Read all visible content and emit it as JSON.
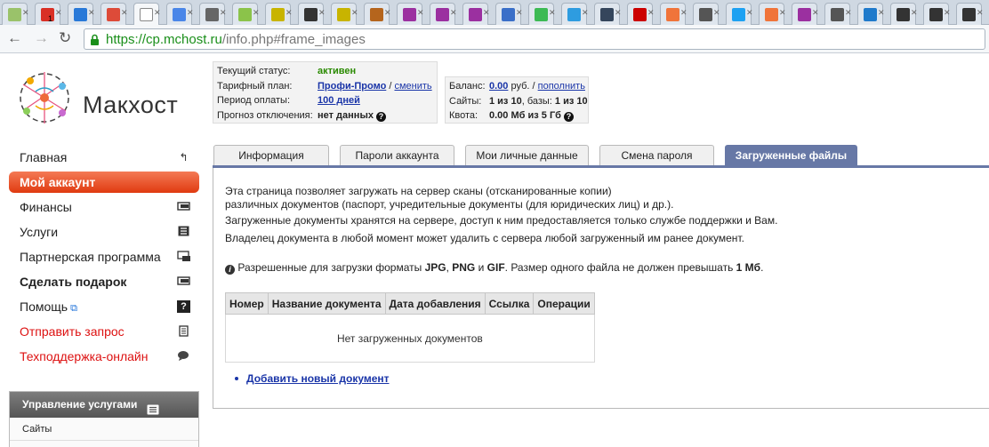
{
  "browser": {
    "tabs": [
      {
        "icon": "favicon-generic-icon",
        "color": "#9ac26a",
        "badge": ""
      },
      {
        "icon": "gmail-icon",
        "color": "#d93025",
        "badge": "1"
      },
      {
        "icon": "favicon-generic-icon",
        "color": "#2979d8",
        "badge": ""
      },
      {
        "icon": "google-plus-icon",
        "color": "#dd4b39",
        "badge": ""
      },
      {
        "icon": "makhost-icon",
        "color": "#ffffff",
        "badge": "",
        "active": true
      },
      {
        "icon": "google-icon",
        "color": "#4a86e8",
        "badge": ""
      },
      {
        "icon": "favicon-generic-icon",
        "color": "#666666",
        "badge": ""
      },
      {
        "icon": "favicon-generic-icon",
        "color": "#8bc34a",
        "badge": ""
      },
      {
        "icon": "favicon-generic-icon",
        "color": "#c8b400",
        "badge": ""
      },
      {
        "icon": "yandex-icon",
        "color": "#333333",
        "badge": ""
      },
      {
        "icon": "favicon-generic-icon",
        "color": "#c8b400",
        "badge": ""
      },
      {
        "icon": "favicon-generic-icon",
        "color": "#b5651d",
        "badge": ""
      },
      {
        "icon": "favicon-generic-icon",
        "color": "#9b30a0",
        "badge": ""
      },
      {
        "icon": "favicon-generic-icon",
        "color": "#9b30a0",
        "badge": ""
      },
      {
        "icon": "favicon-generic-icon",
        "color": "#9b30a0",
        "badge": ""
      },
      {
        "icon": "document-icon",
        "color": "#3a6fc8",
        "badge": ""
      },
      {
        "icon": "chrome-icon",
        "color": "#3cba54",
        "badge": ""
      },
      {
        "icon": "favicon-generic-icon",
        "color": "#2e9ce0",
        "badge": ""
      },
      {
        "icon": "tumblr-icon",
        "color": "#35465c",
        "badge": ""
      },
      {
        "icon": "russia-flag-icon",
        "color": "#cc0000",
        "badge": ""
      },
      {
        "icon": "favicon-generic-icon",
        "color": "#f0743a",
        "badge": ""
      },
      {
        "icon": "speaker-icon",
        "color": "#555555",
        "badge": ""
      },
      {
        "icon": "twitter-icon",
        "color": "#1da1f2",
        "badge": ""
      },
      {
        "icon": "favicon-generic-icon",
        "color": "#f0743a",
        "badge": ""
      },
      {
        "icon": "favicon-generic-icon",
        "color": "#9b30a0",
        "badge": ""
      },
      {
        "icon": "speaker-icon",
        "color": "#555555",
        "badge": ""
      },
      {
        "icon": "dropbox-icon",
        "color": "#1f7acb",
        "badge": ""
      },
      {
        "icon": "favicon-generic-icon",
        "color": "#333333",
        "badge": ""
      },
      {
        "icon": "favicon-generic-icon",
        "color": "#333333",
        "badge": ""
      },
      {
        "icon": "favicon-generic-icon",
        "color": "#333333",
        "badge": ""
      }
    ],
    "url": {
      "scheme": "https://",
      "host": "cp.mchost.ru",
      "path": "/info.php#frame_images"
    }
  },
  "header": {
    "logo_text": "Макхост",
    "status": [
      {
        "label": "Текущий статус:",
        "value": "активен"
      },
      {
        "label": "Тарифный план:",
        "value": "Профи-Промо",
        "sep": " / ",
        "action": "сменить"
      },
      {
        "label": "Период оплаты:",
        "value": "100 дней"
      },
      {
        "label": "Прогноз отключения:",
        "value": "нет данных"
      }
    ],
    "balance": {
      "label": "Баланс:",
      "amount": "0.00",
      "unit": " руб. / ",
      "action": "пополнить"
    },
    "sites": {
      "label": "Сайты:",
      "value": "1 из 10",
      "sep": ", базы: ",
      "db_value": "1 из 10"
    },
    "quota": {
      "label": "Квота:",
      "value": "0.00 Мб из 5 Гб"
    }
  },
  "sidebar": {
    "items": [
      {
        "label": "Главная",
        "icon": "return-arrow-icon"
      },
      {
        "label": "Мой аккаунт",
        "icon": ""
      },
      {
        "label": "Финансы",
        "icon": "cash-icon"
      },
      {
        "label": "Услуги",
        "icon": "list-icon"
      },
      {
        "label": "Партнерская программа",
        "icon": "partner-icon"
      },
      {
        "label": "Сделать подарок",
        "icon": "gift-icon"
      },
      {
        "label": "Помощь",
        "icon": "question-icon"
      },
      {
        "label": "Отправить запрос",
        "icon": "notepad-icon"
      },
      {
        "label": "Техподдержка-онлайн",
        "icon": "chat-icon"
      }
    ],
    "services_panel": {
      "title": "Управление услугами",
      "items": [
        "Сайты"
      ]
    }
  },
  "tabs": [
    {
      "label": "Информация"
    },
    {
      "label": "Пароли аккаунта"
    },
    {
      "label": "Мои личные данные"
    },
    {
      "label": "Смена пароля"
    },
    {
      "label": "Загруженные файлы"
    }
  ],
  "content": {
    "line1": "Эта страница позволяет загружать на сервер сканы (отсканированные копии)",
    "line2": "различных документов (паспорт, учредительные документы (для юридических лиц) и др.).",
    "line3": "Загруженные документы хранятся на сервере, доступ к ним предоставляется только службе поддержки и Вам.",
    "line4": "Владелец документа в любой момент может удалить с сервера любой загруженный им ранее документ.",
    "formats": {
      "prefix": " Разрешенные для загрузки форматы ",
      "f1": "JPG",
      "c1": ", ",
      "f2": "PNG",
      "c2": " и ",
      "f3": "GIF",
      "middle": ". Размер одного файла не должен превышать ",
      "size": "1 Мб",
      "end": "."
    },
    "table": {
      "headers": [
        "Номер",
        "Название документа",
        "Дата добавления",
        "Ссылка",
        "Операции"
      ],
      "empty": "Нет загруженных документов"
    },
    "add_link": "Добавить новый документ"
  },
  "colors": {
    "accent": "#6778a6",
    "active_menu": "#e8532c",
    "link": "#1a35a8",
    "status_green": "#2a8a00"
  }
}
